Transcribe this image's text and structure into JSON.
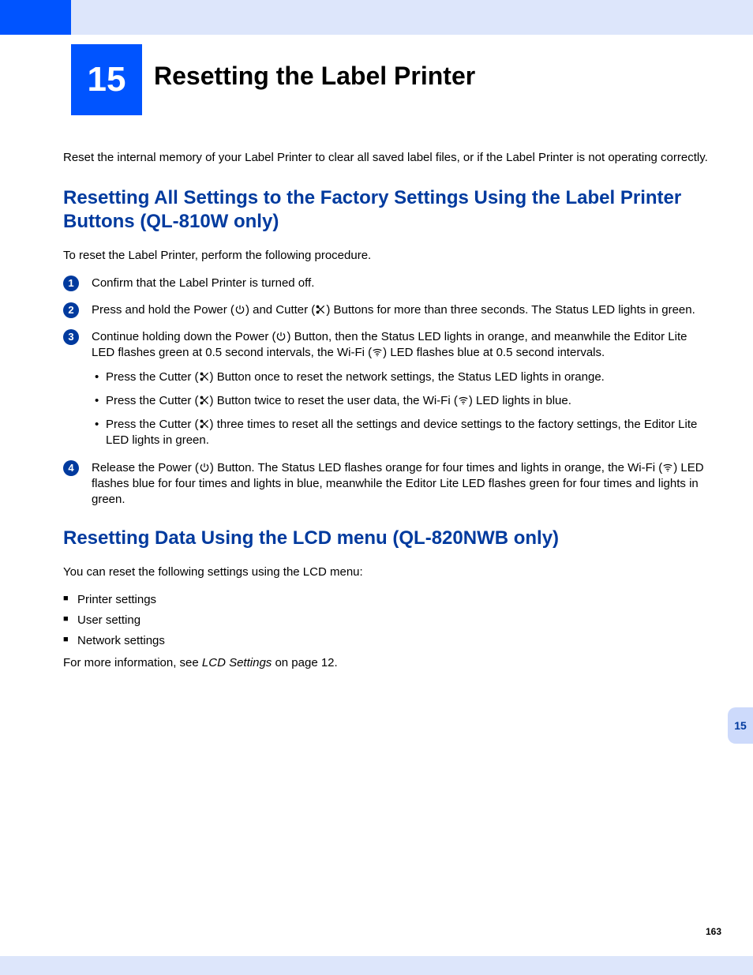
{
  "chapter": {
    "number": "15",
    "title": "Resetting the Label Printer"
  },
  "intro": "Reset the internal memory of your Label Printer to clear all saved label files, or if the Label Printer is not operating correctly.",
  "section1": {
    "heading": "Resetting All Settings to the Factory Settings Using the Label Printer Buttons (QL-810W only)",
    "lead": "To reset the Label Printer, perform the following procedure.",
    "step1": "Confirm that the Label Printer is turned off.",
    "step2_a": "Press and hold the Power (",
    "step2_b": ") and Cutter (",
    "step2_c": ") Buttons for more than three seconds. The Status LED lights in green.",
    "step3_a": "Continue holding down the Power (",
    "step3_b": ") Button, then the Status LED lights in orange, and meanwhile the Editor Lite LED flashes green at 0.5 second intervals, the Wi-Fi (",
    "step3_c": ") LED flashes blue at 0.5 second intervals.",
    "step3_bullet1_a": "Press the Cutter (",
    "step3_bullet1_b": ") Button once to reset the network settings, the Status LED lights in orange.",
    "step3_bullet2_a": "Press the Cutter (",
    "step3_bullet2_b": ") Button twice to reset the user data, the Wi-Fi (",
    "step3_bullet2_c": ") LED lights in blue.",
    "step3_bullet3_a": "Press the Cutter (",
    "step3_bullet3_b": ") three times to reset all the settings and device settings to the factory settings, the Editor Lite LED lights in green.",
    "step4_a": "Release the Power (",
    "step4_b": ") Button. The Status LED flashes orange for four times and lights in orange, the Wi-Fi (",
    "step4_c": ") LED flashes blue for four times and lights in blue, meanwhile the Editor Lite LED flashes green for four times and lights in green."
  },
  "section2": {
    "heading": "Resetting Data Using the LCD menu (QL-820NWB only)",
    "lead": "You can reset the following settings using the LCD menu:",
    "items": {
      "0": "Printer settings",
      "1": "User setting",
      "2": "Network settings"
    },
    "more_a": "For more information, see ",
    "more_em": "LCD Settings",
    "more_b": " on page 12."
  },
  "side_tab": "15",
  "page_number": "163"
}
